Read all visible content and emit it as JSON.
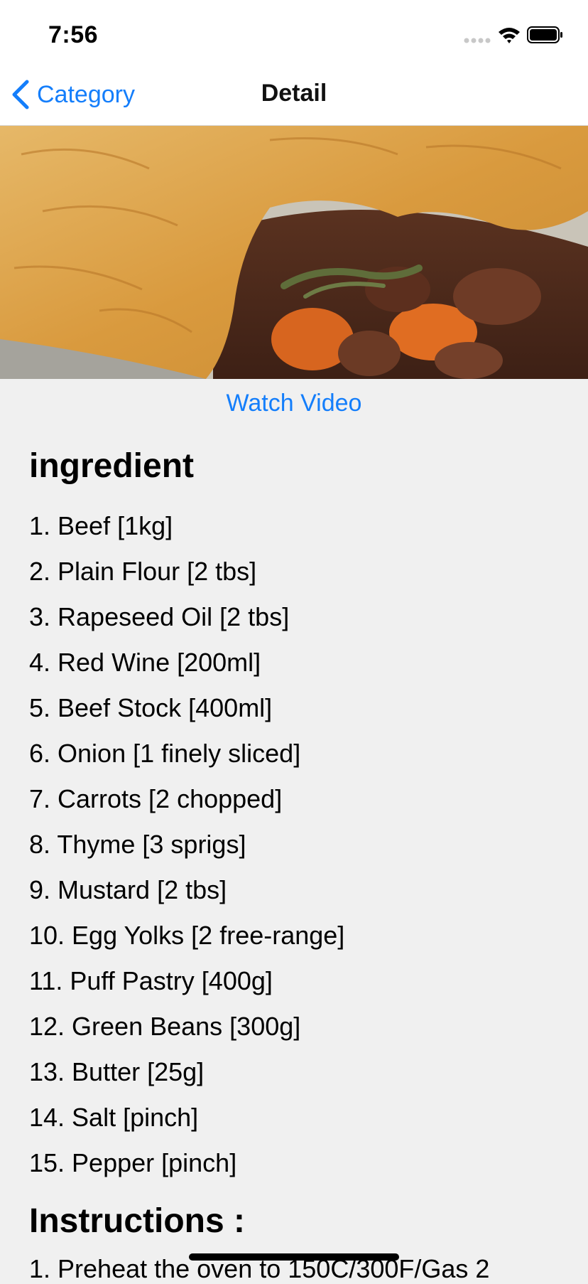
{
  "status_bar": {
    "time": "7:56"
  },
  "nav": {
    "back_label": "Category",
    "title": "Detail"
  },
  "hero": {
    "image_subject": "meat pie with pastry crust, beef stew, carrots and thyme"
  },
  "watch_video_label": "Watch Video",
  "ingredients": {
    "heading": "ingredient",
    "items": [
      "1. Beef [1kg]",
      "2. Plain Flour [2 tbs]",
      "3. Rapeseed Oil [2 tbs]",
      "4. Red Wine [200ml]",
      "5. Beef Stock [400ml]",
      "6. Onion [1 finely sliced]",
      "7. Carrots [2 chopped]",
      "8. Thyme [3 sprigs]",
      "9. Mustard [2 tbs]",
      "10. Egg Yolks [2 free-range]",
      "11. Puff Pastry [400g]",
      "12. Green Beans [300g]",
      "13. Butter [25g]",
      "14. Salt [pinch]",
      "15. Pepper [pinch]"
    ]
  },
  "instructions": {
    "heading": "Instructions :",
    "first_line": "1. Preheat the oven to 150C/300F/Gas 2"
  },
  "colors": {
    "accent": "#147efb",
    "background": "#f0f0f0"
  }
}
